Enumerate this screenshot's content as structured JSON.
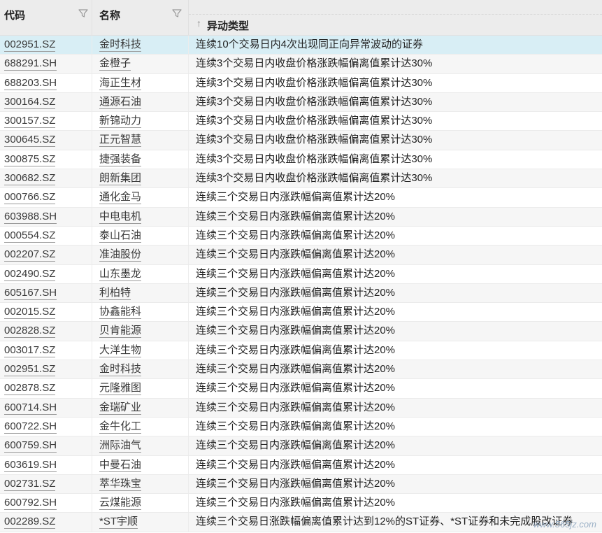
{
  "header": {
    "code_label": "代码",
    "name_label": "名称",
    "type_label": "异动类型",
    "sort_icon": "arrow-up-icon",
    "filter_icon": "funnel-icon"
  },
  "colors": {
    "selected_row": "#d8eef5",
    "alt_row": "#f6f6f6",
    "header_bg": "#ececec"
  },
  "rows": [
    {
      "code": "002951.SZ",
      "name": "金时科技",
      "type": "连续10个交易日内4次出现同正向异常波动的证券"
    },
    {
      "code": "688291.SH",
      "name": "金橙子",
      "type": "连续3个交易日内收盘价格涨跌幅偏离值累计达30%"
    },
    {
      "code": "688203.SH",
      "name": "海正生材",
      "type": "连续3个交易日内收盘价格涨跌幅偏离值累计达30%"
    },
    {
      "code": "300164.SZ",
      "name": "通源石油",
      "type": "连续3个交易日内收盘价格涨跌幅偏离值累计达30%"
    },
    {
      "code": "300157.SZ",
      "name": "新锦动力",
      "type": "连续3个交易日内收盘价格涨跌幅偏离值累计达30%"
    },
    {
      "code": "300645.SZ",
      "name": "正元智慧",
      "type": "连续3个交易日内收盘价格涨跌幅偏离值累计达30%"
    },
    {
      "code": "300875.SZ",
      "name": "捷强装备",
      "type": "连续3个交易日内收盘价格涨跌幅偏离值累计达30%"
    },
    {
      "code": "300682.SZ",
      "name": "朗新集团",
      "type": "连续3个交易日内收盘价格涨跌幅偏离值累计达30%"
    },
    {
      "code": "000766.SZ",
      "name": "通化金马",
      "type": "连续三个交易日内涨跌幅偏离值累计达20%"
    },
    {
      "code": "603988.SH",
      "name": "中电电机",
      "type": "连续三个交易日内涨跌幅偏离值累计达20%"
    },
    {
      "code": "000554.SZ",
      "name": "泰山石油",
      "type": "连续三个交易日内涨跌幅偏离值累计达20%"
    },
    {
      "code": "002207.SZ",
      "name": "准油股份",
      "type": "连续三个交易日内涨跌幅偏离值累计达20%"
    },
    {
      "code": "002490.SZ",
      "name": "山东墨龙",
      "type": "连续三个交易日内涨跌幅偏离值累计达20%"
    },
    {
      "code": "605167.SH",
      "name": "利柏特",
      "type": "连续三个交易日内涨跌幅偏离值累计达20%"
    },
    {
      "code": "002015.SZ",
      "name": "协鑫能科",
      "type": "连续三个交易日内涨跌幅偏离值累计达20%"
    },
    {
      "code": "002828.SZ",
      "name": "贝肯能源",
      "type": "连续三个交易日内涨跌幅偏离值累计达20%"
    },
    {
      "code": "003017.SZ",
      "name": "大洋生物",
      "type": "连续三个交易日内涨跌幅偏离值累计达20%"
    },
    {
      "code": "002951.SZ",
      "name": "金时科技",
      "type": "连续三个交易日内涨跌幅偏离值累计达20%"
    },
    {
      "code": "002878.SZ",
      "name": "元隆雅图",
      "type": "连续三个交易日内涨跌幅偏离值累计达20%"
    },
    {
      "code": "600714.SH",
      "name": "金瑞矿业",
      "type": "连续三个交易日内涨跌幅偏离值累计达20%"
    },
    {
      "code": "600722.SH",
      "name": "金牛化工",
      "type": "连续三个交易日内涨跌幅偏离值累计达20%"
    },
    {
      "code": "600759.SH",
      "name": "洲际油气",
      "type": "连续三个交易日内涨跌幅偏离值累计达20%"
    },
    {
      "code": "603619.SH",
      "name": "中曼石油",
      "type": "连续三个交易日内涨跌幅偏离值累计达20%"
    },
    {
      "code": "002731.SZ",
      "name": "萃华珠宝",
      "type": "连续三个交易日内涨跌幅偏离值累计达20%"
    },
    {
      "code": "600792.SH",
      "name": "云煤能源",
      "type": "连续三个交易日内涨跌幅偏离值累计达20%"
    },
    {
      "code": "002289.SZ",
      "name": "*ST宇顺",
      "type": "连续三个交易日涨跌幅偏离值累计达到12%的ST证券、*ST证券和未完成股改证券"
    }
  ],
  "selected_index": 0,
  "watermark": "www.565jz.com"
}
